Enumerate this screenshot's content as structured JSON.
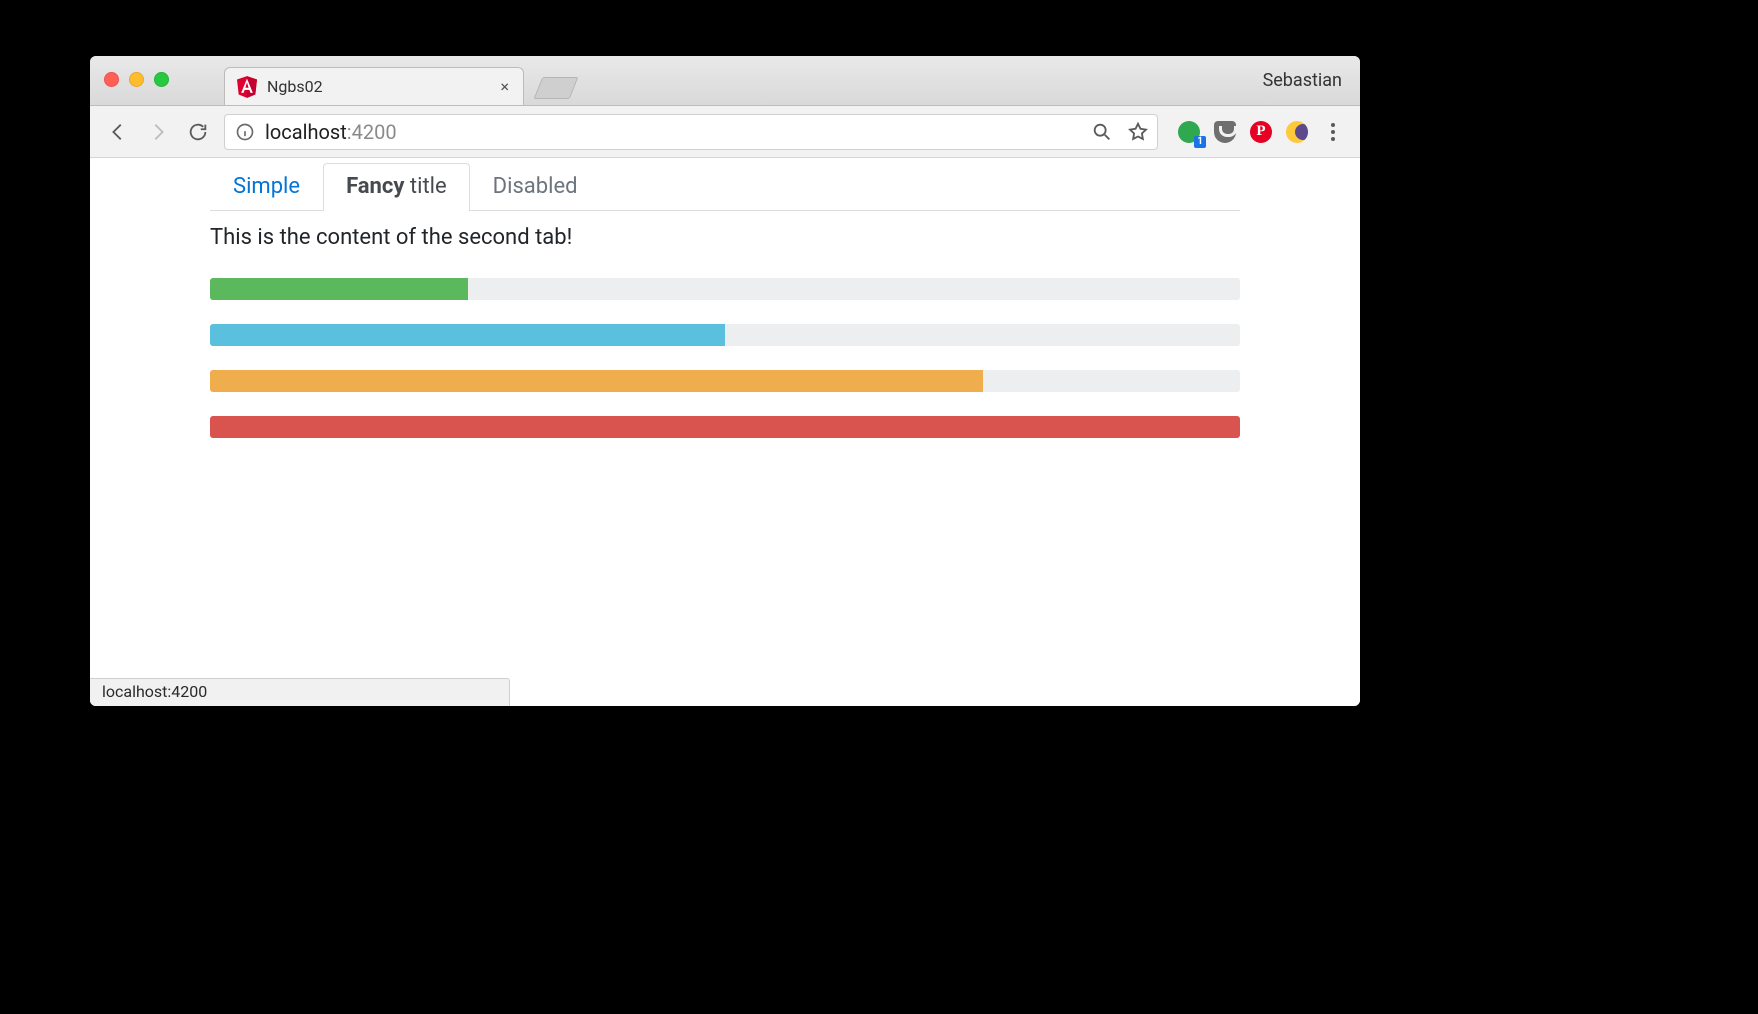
{
  "browser": {
    "profile_name": "Sebastian",
    "tab": {
      "title": "Ngbs02",
      "favicon": "angular"
    },
    "address": {
      "host": "localhost",
      "port": ":4200"
    },
    "extensions": {
      "green_badge": "1"
    },
    "status_text": "localhost:4200"
  },
  "page": {
    "tabs": [
      {
        "label": "Simple",
        "state": "link"
      },
      {
        "label_bold": "Fancy",
        "label_rest": " title",
        "state": "active"
      },
      {
        "label": "Disabled",
        "state": "disabled"
      }
    ],
    "content_text": "This is the content of the second tab!",
    "progress": [
      {
        "type": "success",
        "value": 25
      },
      {
        "type": "info",
        "value": 50
      },
      {
        "type": "warning",
        "value": 75
      },
      {
        "type": "danger",
        "value": 100
      }
    ]
  }
}
